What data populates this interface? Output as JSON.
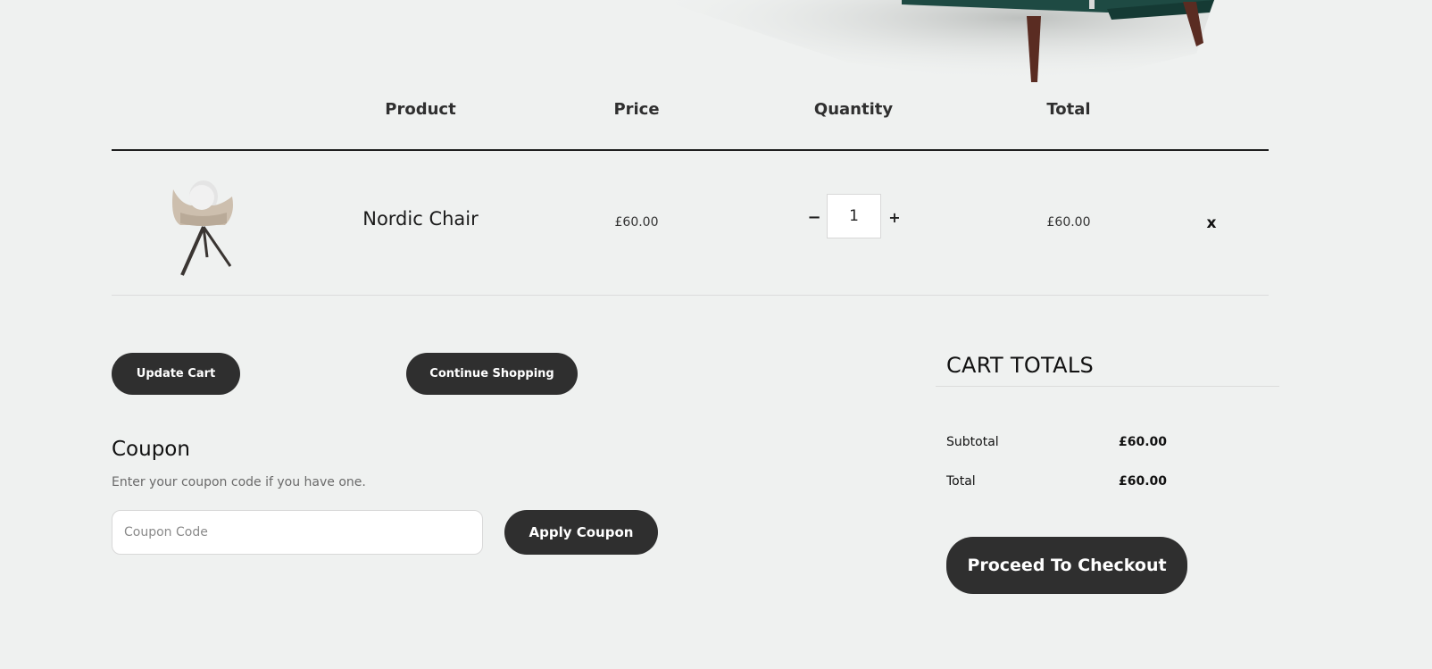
{
  "table": {
    "headers": {
      "product": "Product",
      "price": "Price",
      "quantity": "Quantity",
      "total": "Total"
    },
    "items": [
      {
        "name": "Nordic Chair",
        "price": "£60.00",
        "quantity": "1",
        "total": "£60.00",
        "decrement": "−",
        "increment": "+",
        "remove": "x"
      }
    ]
  },
  "actions": {
    "update_cart": "Update Cart",
    "continue_shopping": "Continue Shopping"
  },
  "coupon": {
    "title": "Coupon",
    "description": "Enter your coupon code if you have one.",
    "placeholder": "Coupon Code",
    "apply_label": "Apply Coupon"
  },
  "totals": {
    "title": "CART TOTALS",
    "subtotal_label": "Subtotal",
    "subtotal_value": "£60.00",
    "total_label": "Total",
    "total_value": "£60.00",
    "checkout_label": "Proceed To Checkout"
  },
  "colors": {
    "background": "#eff1f0",
    "button": "#2f2f2f",
    "sofa_green": "#1e4a43"
  }
}
